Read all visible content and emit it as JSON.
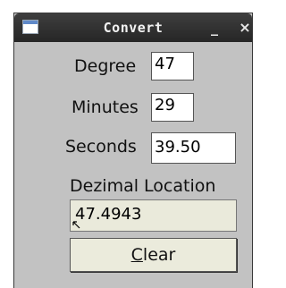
{
  "window": {
    "title": "Convert",
    "minimize_glyph": "_",
    "close_glyph": "×",
    "icon": "window-app-icon"
  },
  "form": {
    "degree_label": "Degree",
    "degree_value": "47",
    "minutes_label": "Minutes",
    "minutes_value": "29",
    "seconds_label": "Seconds",
    "seconds_value": "39.50",
    "result_label": "Dezimal Location",
    "result_value": "47.4943"
  },
  "clear_button": {
    "mnemonic": "C",
    "rest": "lear"
  }
}
